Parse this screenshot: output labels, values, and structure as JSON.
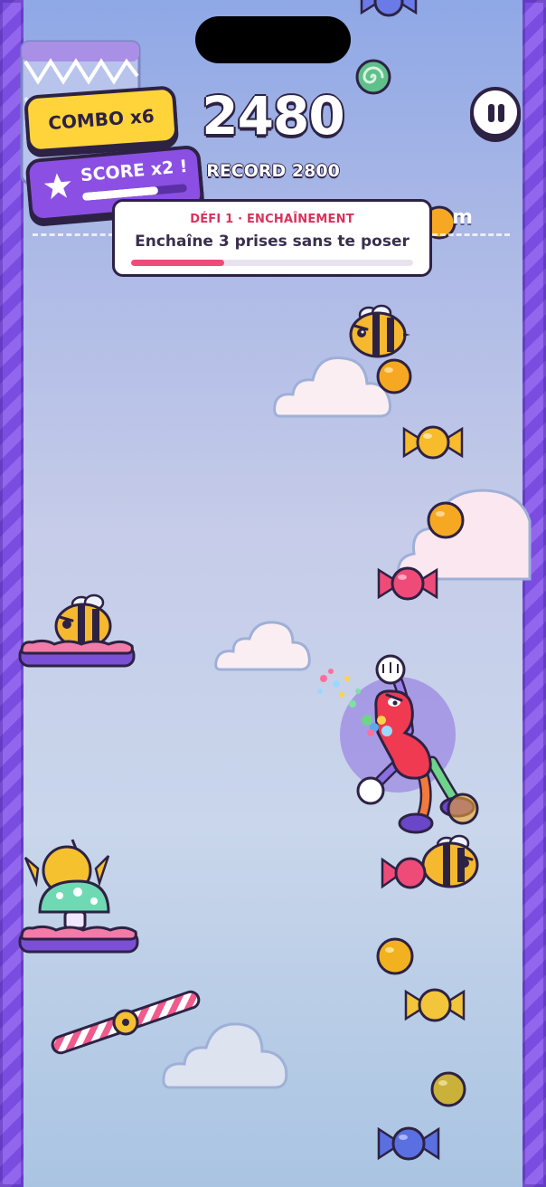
{
  "hud": {
    "combo_label": "COMBO x6",
    "multiplier_label": "SCORE x2 !",
    "multiplier_timer_fraction": 0.72,
    "score": "2480",
    "record": "RECORD 2800",
    "pause_icon": "pause-icon",
    "height_unit": "m"
  },
  "challenge": {
    "title": "DÉFI 1 · ENCHAÎNEMENT",
    "description": "Enchaîne 3 prises sans te poser",
    "progress_fraction": 0.33
  },
  "colors": {
    "combo_badge": "#ffd43a",
    "multiplier_badge": "#8b4fe3",
    "challenge_accent": "#d8335d",
    "progress_fill": "#ef4b78",
    "outline": "#2d2244",
    "walls": "#8556e8"
  },
  "scene": {
    "player": "stretchy-red-climber",
    "enemies": [
      "bee-icon",
      "bee-icon",
      "bee-icon"
    ],
    "collectibles": [
      "orange-candy",
      "yellow-wrapped-candy",
      "pink-wrapped-candy",
      "blue-wrapped-candy",
      "green-swirl-candy"
    ],
    "platforms": [
      "pink-jelly-ledge",
      "pink-jelly-ledge",
      "striped-candy-cane-seesaw",
      "mushroom-bouncer"
    ]
  }
}
